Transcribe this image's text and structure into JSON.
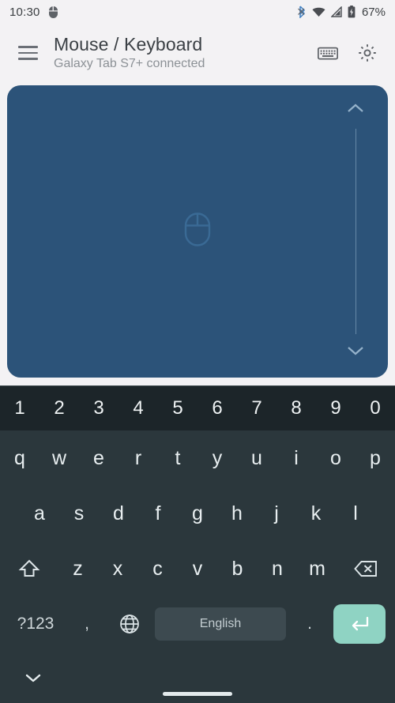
{
  "status_bar": {
    "time": "10:30",
    "left_icons": [
      "mouse-icon"
    ],
    "right_icons": [
      "bluetooth-icon",
      "wifi-icon",
      "cellular-signal-icon",
      "battery-charging-icon"
    ],
    "battery_percent": "67%",
    "colors": {
      "text": "#3c4043",
      "bluetooth": "#3f7fc1",
      "background": "#f3f2f4"
    }
  },
  "app_bar": {
    "menu_icon": "hamburger-menu-icon",
    "title": "Mouse / Keyboard",
    "subtitle": "Galaxy Tab S7+ connected",
    "actions": [
      {
        "name": "keyboard-toggle-button",
        "icon": "keyboard-icon"
      },
      {
        "name": "settings-button",
        "icon": "gear-icon"
      }
    ]
  },
  "touchpad": {
    "label": "touchpad-surface",
    "watermark_icon": "mouse-icon",
    "scroll_up_icon": "chevron-up-icon",
    "scroll_down_icon": "chevron-down-icon",
    "colors": {
      "surface": "#2c5379",
      "accent": "#adc9e0"
    }
  },
  "keyboard": {
    "language": "English",
    "colors": {
      "background": "#2b373c",
      "number_row_background": "#1c2529",
      "key_text": "#e8eef0",
      "spacebar": "#3d4a50",
      "enter": "#8fd3c3"
    },
    "rows": {
      "numbers": [
        "1",
        "2",
        "3",
        "4",
        "5",
        "6",
        "7",
        "8",
        "9",
        "0"
      ],
      "top": [
        "q",
        "w",
        "e",
        "r",
        "t",
        "y",
        "u",
        "i",
        "o",
        "p"
      ],
      "home": [
        "a",
        "s",
        "d",
        "f",
        "g",
        "h",
        "j",
        "k",
        "l"
      ],
      "bottom": [
        "z",
        "x",
        "c",
        "v",
        "b",
        "n",
        "m"
      ]
    },
    "special_keys": {
      "shift": "shift-icon",
      "backspace": "backspace-icon",
      "symbols": "?123",
      "comma": ",",
      "globe": "globe-icon",
      "period": ".",
      "enter": "enter-icon"
    }
  },
  "nav_bar": {
    "hide_keyboard_icon": "chevron-down-icon",
    "home_gesture_pill": "home-pill"
  }
}
